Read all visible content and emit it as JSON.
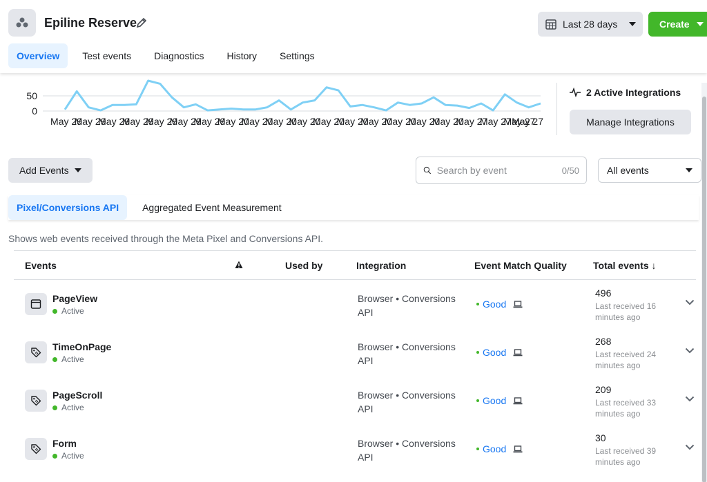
{
  "header": {
    "title": "Epiline Reserve",
    "date_range": "Last 28 days",
    "create_label": "Create",
    "tabs": [
      {
        "label": "Overview",
        "active": true
      },
      {
        "label": "Test events"
      },
      {
        "label": "Diagnostics"
      },
      {
        "label": "History"
      },
      {
        "label": "Settings"
      }
    ]
  },
  "chart_data": {
    "type": "line",
    "y_ticks": [
      "50",
      "0"
    ],
    "x": [
      "May 29",
      "May 29",
      "May 29",
      "May 29",
      "May 29",
      "May 29",
      "May 29",
      "May 29",
      "May 29",
      "May 20",
      "May 20",
      "May 20",
      "May 20",
      "May 20",
      "May 20",
      "May 20",
      "May 20",
      "May 20",
      "May 20",
      "May 20",
      "May 20",
      "May 20",
      "May 27",
      "May 27",
      "May 27",
      "May 27",
      "May 27",
      "May 27"
    ],
    "x_tick_labels": [
      "May 29",
      "May 29",
      "May 29",
      "May 29",
      "May 29",
      "May 29",
      "May 29",
      "May 20",
      "May 20",
      "May 20",
      "May 20",
      "May 20",
      "May 20",
      "May 20",
      "May 20",
      "May 20",
      "May 20",
      "May 27",
      "May 27",
      "May 27",
      "May 27"
    ],
    "values": [
      5,
      65,
      12,
      2,
      20,
      20,
      22,
      100,
      90,
      45,
      12,
      22,
      2,
      5,
      8,
      5,
      5,
      12,
      35,
      5,
      28,
      35,
      78,
      68,
      15,
      20,
      12,
      2,
      28,
      20,
      25,
      45,
      20,
      18,
      10,
      25,
      2,
      55,
      28,
      12,
      25
    ],
    "ylim": [
      0,
      100
    ],
    "line_color": "#7fd0f5"
  },
  "integrations": {
    "label": "2 Active Integrations",
    "manage_label": "Manage Integrations"
  },
  "controls": {
    "add_events": "Add Events",
    "search_placeholder": "Search by event",
    "search_count": "0/50",
    "filter": "All events"
  },
  "subtabs": [
    {
      "label": "Pixel/Conversions API",
      "active": true
    },
    {
      "label": "Aggregated Event Measurement"
    }
  ],
  "description": "Shows web events received through the Meta Pixel and Conversions API.",
  "table": {
    "headers": {
      "events": "Events",
      "used_by": "Used by",
      "integration": "Integration",
      "quality": "Event Match Quality",
      "total": "Total events ↓"
    },
    "rows": [
      {
        "name": "PageView",
        "status": "Active",
        "integration": "Browser • Conversions API",
        "quality": "Good",
        "total": "496",
        "received": "Last received 16 minutes ago",
        "icon": "browser-icon"
      },
      {
        "name": "TimeOnPage",
        "status": "Active",
        "integration": "Browser • Conversions API",
        "quality": "Good",
        "total": "268",
        "received": "Last received 24 minutes ago",
        "icon": "tag-icon"
      },
      {
        "name": "PageScroll",
        "status": "Active",
        "integration": "Browser • Conversions API",
        "quality": "Good",
        "total": "209",
        "received": "Last received 33 minutes ago",
        "icon": "tag-icon"
      },
      {
        "name": "Form",
        "status": "Active",
        "integration": "Browser • Conversions API",
        "quality": "Good",
        "total": "30",
        "received": "Last received 39 minutes ago",
        "icon": "tag-icon"
      }
    ]
  }
}
